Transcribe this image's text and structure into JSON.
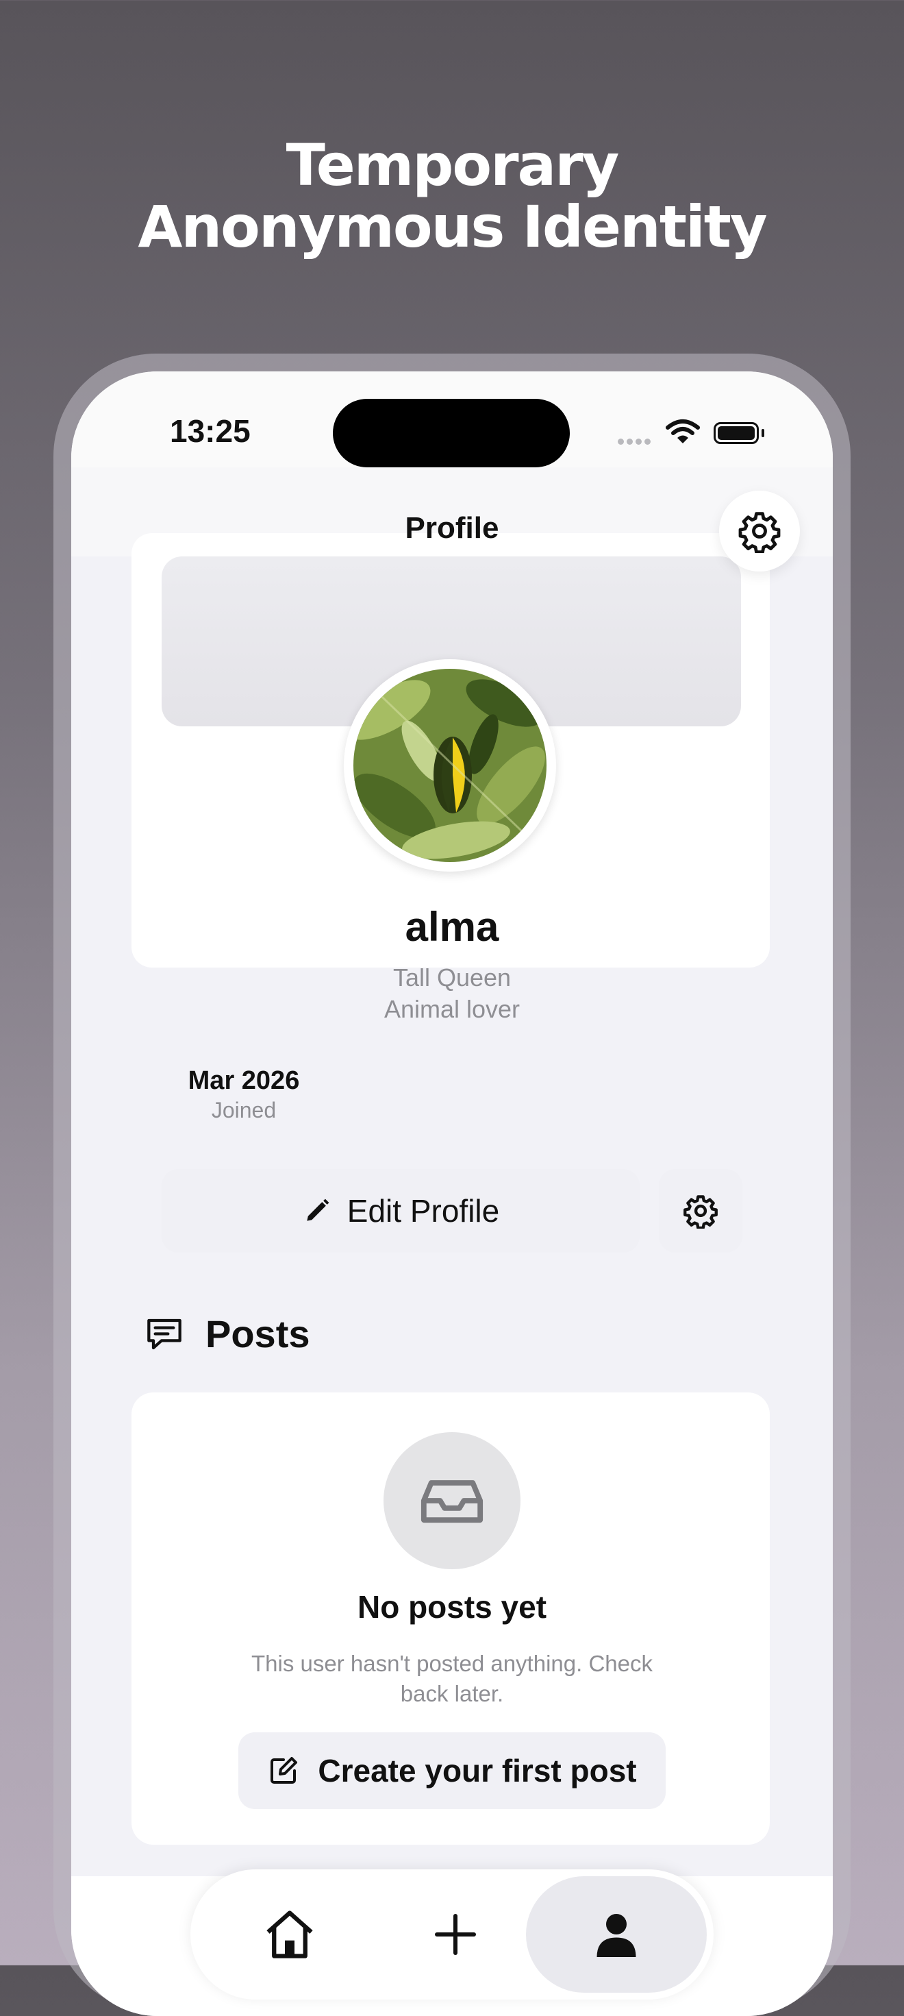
{
  "headline": {
    "line1": "Temporary",
    "line2": "Anonymous Identity"
  },
  "status_bar": {
    "time": "13:25"
  },
  "header": {
    "title": "Profile"
  },
  "profile": {
    "name": "alma",
    "bio_line1": "Tall Queen",
    "bio_line2": "Animal lover",
    "joined_value": "Mar 2026",
    "joined_label": "Joined",
    "edit_label": "Edit Profile"
  },
  "posts": {
    "title": "Posts",
    "empty_title": "No posts yet",
    "empty_text": "This user hasn't posted anything. Check back later.",
    "create_label": "Create your first post"
  },
  "tab_bar": {
    "items": [
      {
        "icon": "home-icon",
        "selected": false
      },
      {
        "icon": "plus-icon",
        "selected": false
      },
      {
        "icon": "person-icon",
        "selected": true
      }
    ]
  },
  "colors": {
    "background_top": "#58545a",
    "background_bottom": "#b9aebd",
    "screen_bg": "#f2f2f7",
    "card_bg": "#ffffff",
    "button_bg": "#f0f0f5",
    "secondary_text": "#8e8e93",
    "primary_text": "#111111"
  }
}
